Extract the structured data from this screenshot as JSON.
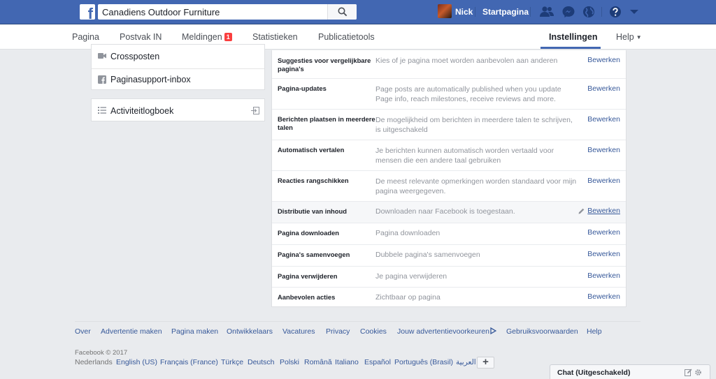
{
  "header": {
    "search_value": "Canadiens Outdoor Furniture",
    "profile_name": "Nick",
    "home_label": "Startpagina"
  },
  "nav": {
    "items": [
      "Pagina",
      "Postvak IN",
      "Meldingen",
      "Statistieken",
      "Publicatietools",
      "Instellingen",
      "Help"
    ],
    "notifications_badge": "1",
    "active": "Instellingen"
  },
  "sidebar": {
    "items": [
      "Crossposten",
      "Paginasupport-inbox"
    ],
    "activity_log": "Activiteitlogboek"
  },
  "settings": {
    "edit_label": "Bewerken",
    "rows": [
      {
        "name": "Suggesties voor vergelijkbare pagina's",
        "desc": "Kies of je pagina moet worden aanbevolen aan anderen"
      },
      {
        "name": "Pagina-updates",
        "desc": "Page posts are automatically published when you update Page info, reach milestones, receive reviews and more."
      },
      {
        "name": "Berichten plaatsen in meerdere talen",
        "desc": "De mogelijkheid om berichten in meerdere talen te schrijven, is uitgeschakeld"
      },
      {
        "name": "Automatisch vertalen",
        "desc": "Je berichten kunnen automatisch worden vertaald voor mensen die een andere taal gebruiken"
      },
      {
        "name": "Reacties rangschikken",
        "desc": "De meest relevante opmerkingen worden standaard voor mijn pagina weergegeven."
      },
      {
        "name": "Distributie van inhoud",
        "desc": "Downloaden naar Facebook is toegestaan."
      },
      {
        "name": "Pagina downloaden",
        "desc": "Pagina downloaden"
      },
      {
        "name": "Pagina's samenvoegen",
        "desc": "Dubbele pagina's samenvoegen"
      },
      {
        "name": "Pagina verwijderen",
        "desc": "Je pagina verwijderen"
      },
      {
        "name": "Aanbevolen acties",
        "desc": "Zichtbaar op pagina"
      }
    ]
  },
  "footer": {
    "links": [
      "Over",
      "Advertentie maken",
      "Pagina maken",
      "Ontwikkelaars",
      "Vacatures",
      "Privacy",
      "Cookies",
      "Jouw advertentievoorkeuren",
      "Gebruiksvoorwaarden",
      "Help"
    ],
    "copyright": "Facebook © 2017",
    "languages": [
      "Nederlands",
      "English (US)",
      "Français (France)",
      "Türkçe",
      "Deutsch",
      "Polski",
      "Română",
      "Italiano",
      "Español",
      "Português (Brasil)",
      "العربية"
    ],
    "add_language": "+"
  },
  "chat": {
    "label": "Chat (Uitgeschakeld)"
  },
  "colors": {
    "brand_blue": "#4267b2",
    "link_blue": "#365899",
    "badge_red": "#fa3e3e",
    "background": "#e9ebee"
  }
}
